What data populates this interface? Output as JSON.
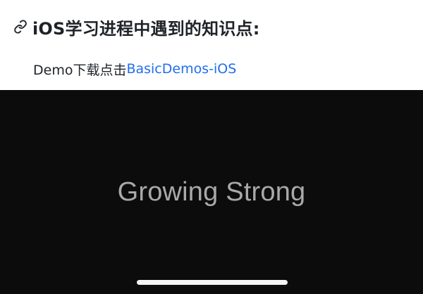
{
  "header": {
    "icon": "link-icon",
    "title": "iOS学习进程中遇到的知识点:"
  },
  "paragraph": {
    "prefix": "Demo下载点击",
    "link_text": "BasicDemos-iOS",
    "link_color": "#1f6feb"
  },
  "video": {
    "background": "#0c0c0c",
    "text": "Growing Strong"
  },
  "home_indicator": {
    "icon": "home-indicator"
  }
}
